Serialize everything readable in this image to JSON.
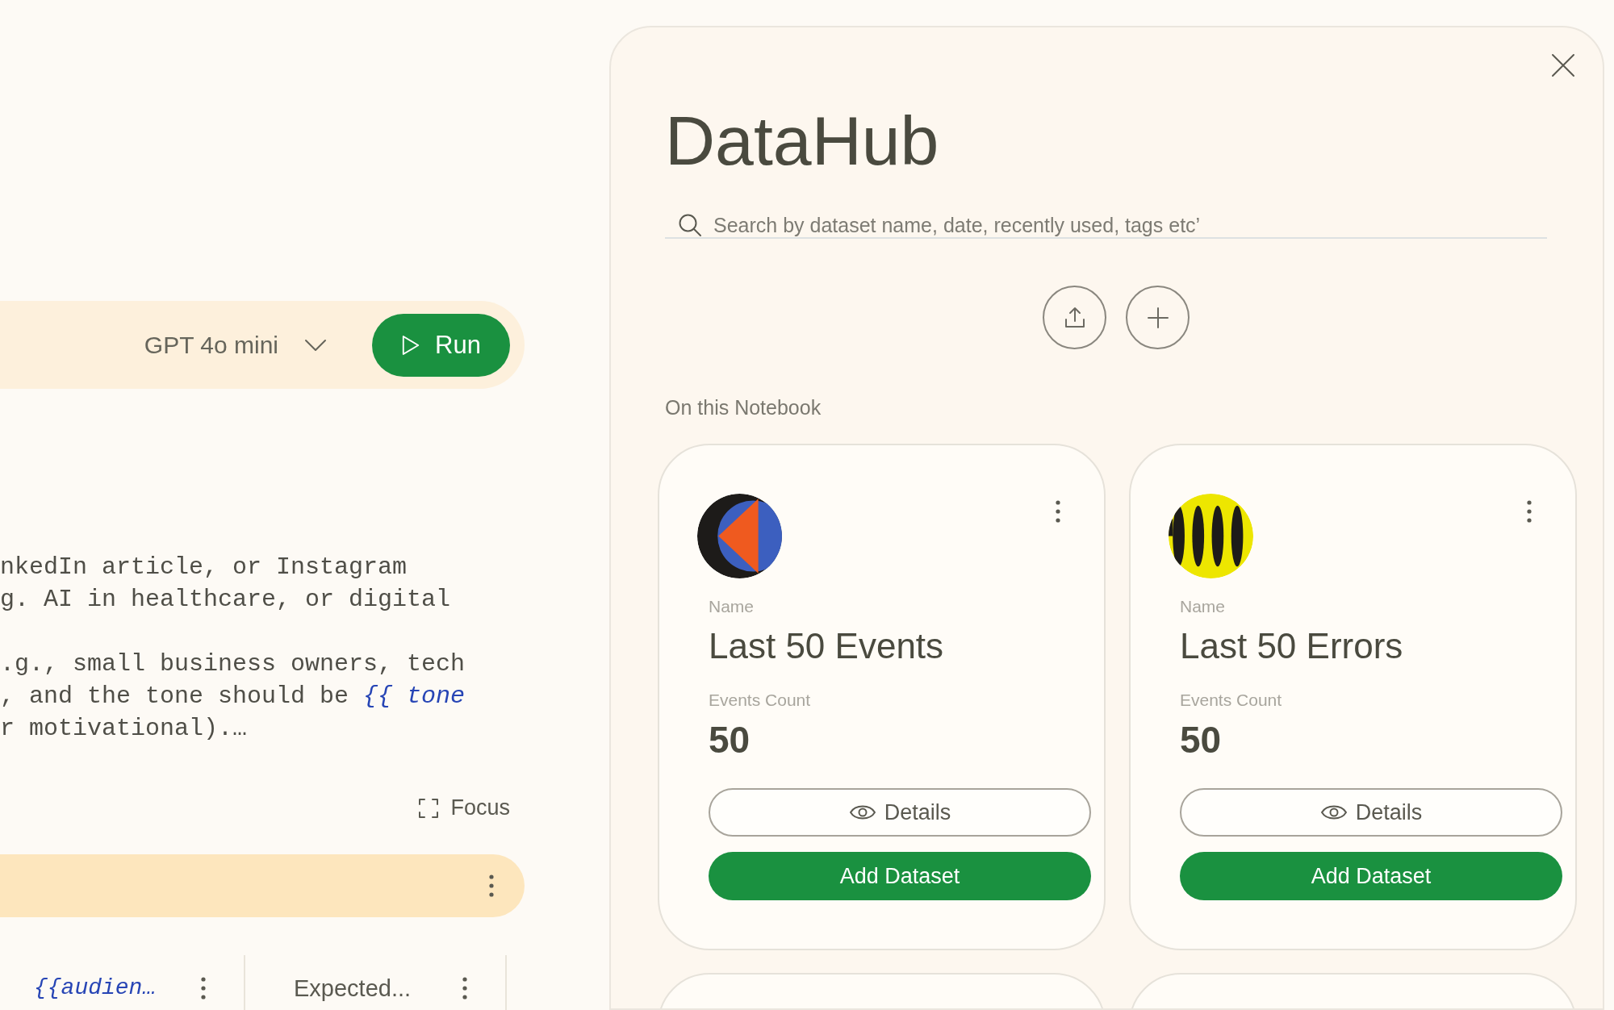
{
  "editor": {
    "toolbar": {
      "model": "GPT 4o mini",
      "run_label": "Run"
    },
    "prompt_paragraphs": [
      [
        "nkedIn article, or Instagram",
        "g. AI in healthcare, or digital"
      ],
      [
        ".g., small business owners, tech",
        ", and the tone should be *{{ tone*",
        "r motivational).…"
      ]
    ],
    "focus_label": "Focus",
    "columns": [
      {
        "label": "{{audien…",
        "kind": "variable"
      },
      {
        "label": "Expected...",
        "kind": "plain"
      }
    ]
  },
  "datahub": {
    "title": "DataHub",
    "search": {
      "placeholder": "Search by dataset name, date, recently used, tags etc’"
    },
    "section_title": "On this Notebook",
    "datasets": [
      {
        "kind": "triangle-art",
        "name_label": "Name",
        "name": "Last 50 Events",
        "count_label": "Events Count",
        "count": "50",
        "details_label": "Details",
        "add_label": "Add Dataset"
      },
      {
        "kind": "wave-art",
        "name_label": "Name",
        "name": "Last 50 Errors",
        "count_label": "Events Count",
        "count": "50",
        "details_label": "Details",
        "add_label": "Add Dataset"
      },
      {
        "kind": "peek"
      },
      {
        "kind": "peek"
      }
    ]
  }
}
